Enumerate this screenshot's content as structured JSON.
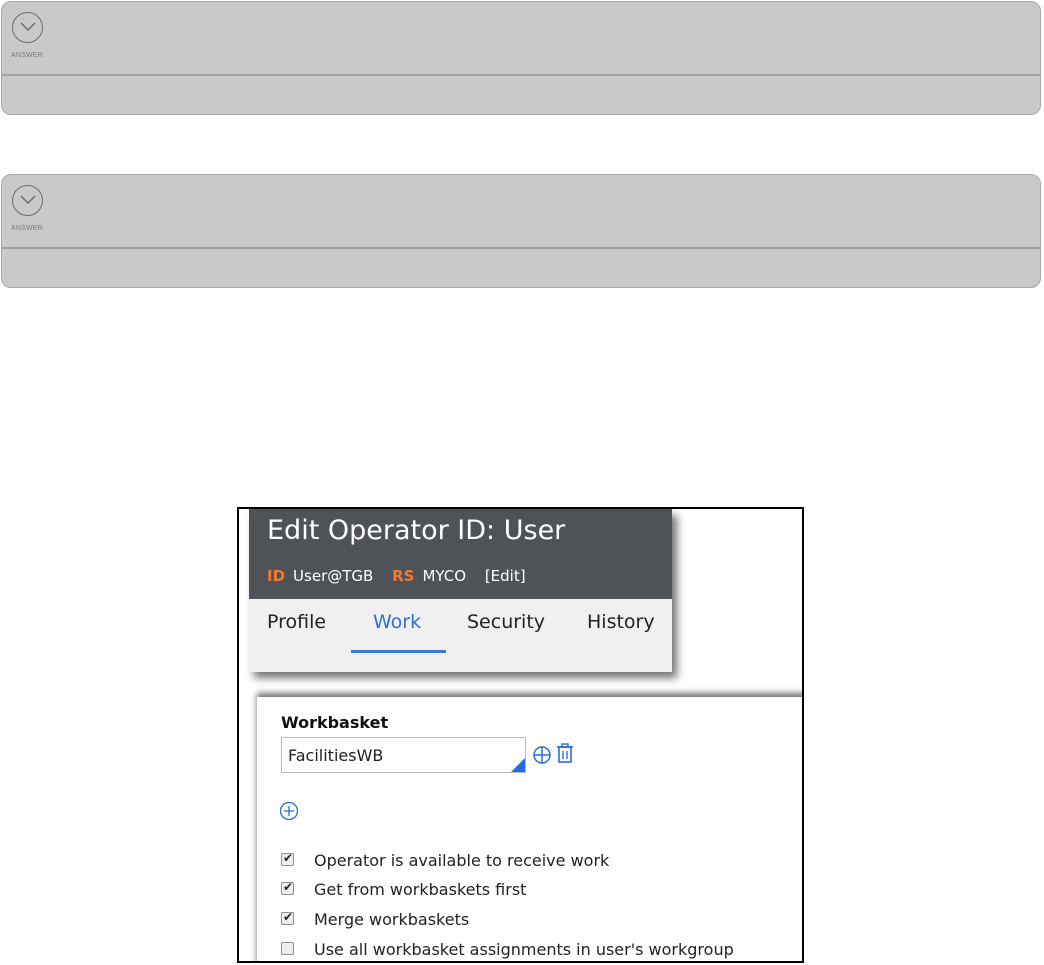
{
  "answer_panels": [
    {
      "toggle_label": "ANSWER"
    },
    {
      "toggle_label": "ANSWER"
    }
  ],
  "operator": {
    "title": "Edit Operator ID: User",
    "id_key": "ID",
    "id_value": "User@TGB",
    "rs_key": "RS",
    "rs_value": "MYCO",
    "edit_link": "[Edit]"
  },
  "tabs": [
    "Profile",
    "Work",
    "Security",
    "History"
  ],
  "active_tab": "Work",
  "work": {
    "section_label": "Workbasket",
    "workbasket_value": "FacilitiesWB",
    "checkboxes": [
      {
        "label": "Operator is available to receive work",
        "checked": true
      },
      {
        "label": "Get from workbaskets first",
        "checked": true
      },
      {
        "label": "Merge workbaskets",
        "checked": true
      },
      {
        "label": "Use all workbasket assignments in user's workgroup",
        "checked": false
      }
    ]
  },
  "colors": {
    "header_bg": "#4f5257",
    "accent_orange": "#f07a33",
    "active_tab": "#2a6fd6",
    "panel_bg": "#c9c9c9"
  }
}
